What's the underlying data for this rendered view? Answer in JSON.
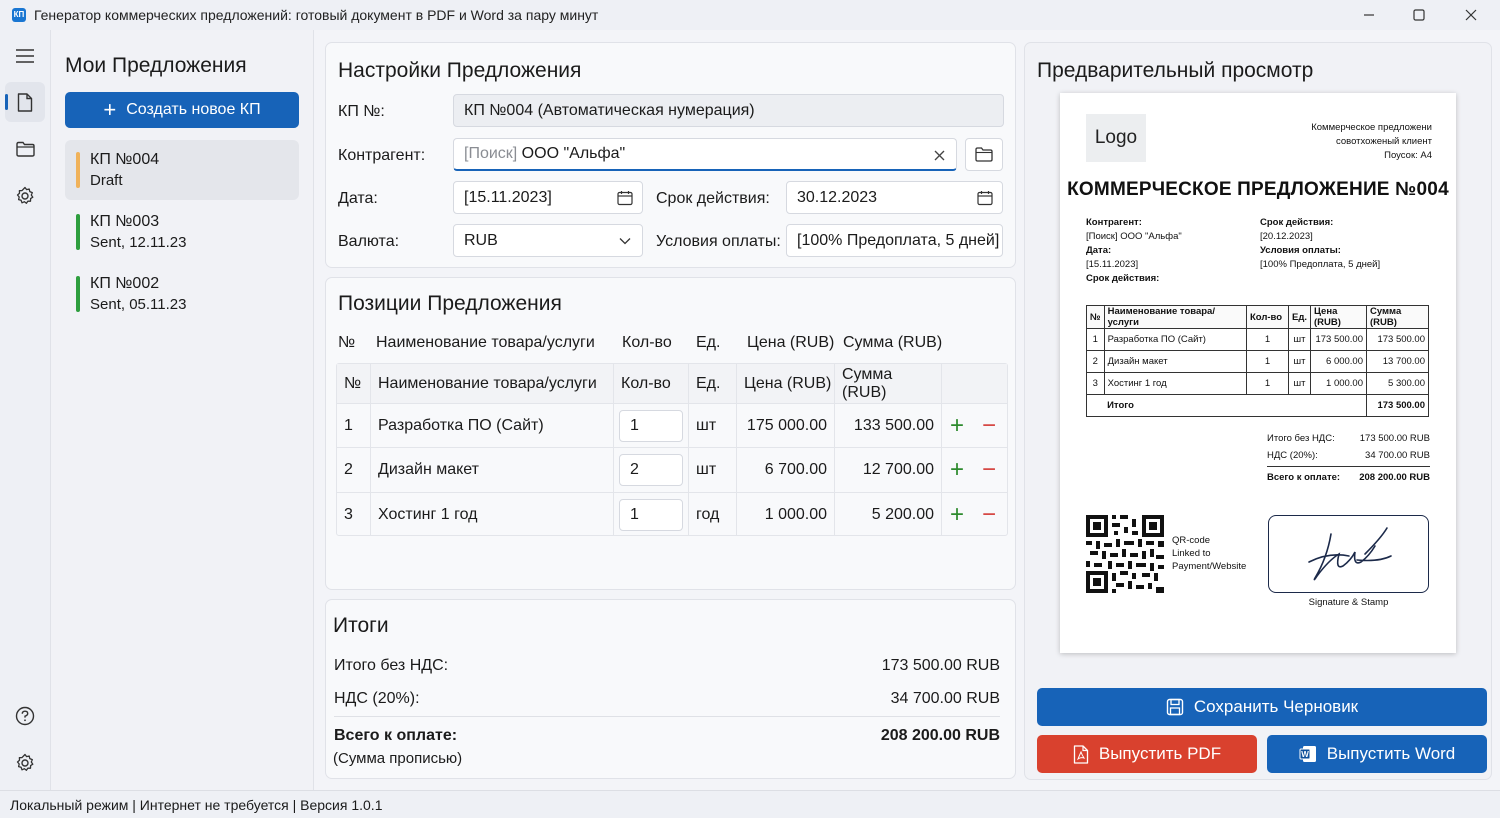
{
  "window": {
    "title": "Генератор коммерческих предложений: готовый документ в PDF и Word за пару минут",
    "app_icon_text": "КП"
  },
  "sidebar": {
    "title": "Мои Предложения",
    "create_button": "Создать новое КП",
    "offers": [
      {
        "title": "КП №004",
        "status": "Draft",
        "color": "#f0b25a"
      },
      {
        "title": "КП №003",
        "status": "Sent, 12.11.23",
        "color": "#2e9e3e"
      },
      {
        "title": "КП №002",
        "status": "Sent, 05.11.23",
        "color": "#2e9e3e"
      }
    ]
  },
  "settings": {
    "title": "Настройки Предложения",
    "number_label": "КП №:",
    "number_value": "КП №004 (Автоматическая нумерация)",
    "contractor_label": "Контрагент:",
    "contractor_placeholder": "[Поиск]",
    "contractor_value": " ООО \"Альфа\"",
    "date_label": "Дата:",
    "date_value": "[15.11.2023]",
    "validity_label": "Срок действия:",
    "validity_value": "30.12.2023",
    "currency_label": "Валюта:",
    "currency_value": "RUB",
    "payment_label": "Условия оплаты:",
    "payment_value": "[100% Предоплата, 5 дней]"
  },
  "positions": {
    "title": "Позиции Предложения",
    "columns": [
      "№",
      "Наименование товара/услуги",
      "Кол-во",
      "Ед.",
      "Цена (RUB)",
      "Сумма (RUB)"
    ],
    "rows": [
      {
        "n": "1",
        "name": "Разработка ПО (Сайт)",
        "qty": "1",
        "unit": "шт",
        "price": "175 000.00",
        "sum": "133 500.00"
      },
      {
        "n": "2",
        "name": "Дизайн макет",
        "qty": "2",
        "unit": "шт",
        "price": "6 700.00",
        "sum": "12 700.00"
      },
      {
        "n": "3",
        "name": "Хостинг 1 год",
        "qty": "1",
        "unit": "год",
        "price": "1 000.00",
        "sum": "5 200.00"
      }
    ]
  },
  "totals": {
    "title": "Итоги",
    "net_label": "Итого без НДС:",
    "net_value": "173 500.00 RUB",
    "vat_label": "НДС (20%):",
    "vat_value": "34 700.00 RUB",
    "total_label": "Всего к оплате:",
    "total_value": "208 200.00 RUB",
    "words_label": "(Сумма прописью)"
  },
  "preview": {
    "title": "Предварительный просмотр",
    "logo": "Logo",
    "header_lines": [
      "Коммерческое предложени",
      "совотхоженый клиент",
      "Поусок: А4"
    ],
    "doc_title": "КОММЕРЧЕСКОЕ ПРЕДЛОЖЕНИЕ №004",
    "left_info": [
      {
        "label": "Контрагент:",
        "value": "[Поиск] ООО \"Альфа\""
      },
      {
        "label": "Дата:",
        "value": "[15.11.2023]"
      },
      {
        "label": "Срок действия:",
        "value": ""
      }
    ],
    "right_info": [
      {
        "label": "Срок действия:",
        "value": "[20.12.2023]"
      },
      {
        "label": "Условия оплаты:",
        "value": "[100% Предоплата, 5 дней]"
      }
    ],
    "table_head": [
      "№",
      "Наименование товара/услуги",
      "Кол-во",
      "Ед.",
      "Цена (RUB)",
      "Сумма (RUB)"
    ],
    "table_rows": [
      [
        "1",
        "Разработка ПО (Сайт)",
        "1",
        "шт",
        "173 500.00",
        "173 500.00"
      ],
      [
        "2",
        "Дизайн макет",
        "1",
        "шт",
        "6 000.00",
        "13 700.00"
      ],
      [
        "3",
        "Хостинг 1 год",
        "1",
        "шт",
        "1 000.00",
        "5 300.00"
      ]
    ],
    "table_total_label": "Итого",
    "table_total_value": "173 500.00",
    "sum_net_label": "Итого без НДС:",
    "sum_net_value": "173 500.00 RUB",
    "sum_vat_label": "НДС (20%):",
    "sum_vat_value": "34 700.00 RUB",
    "sum_total_label": "Всего к оплате:",
    "sum_total_value": "208 200.00 RUB",
    "qr_text": [
      "QR-code",
      "Linked to",
      "Payment/Website"
    ],
    "signature_caption": "Signature & Stamp"
  },
  "actions": {
    "save_draft": "Сохранить Черновик",
    "issue_pdf": "Выпустить PDF",
    "issue_word": "Выпустить Word",
    "save_color": "#1763b8",
    "pdf_color": "#d9412e",
    "word_color": "#1763b8"
  },
  "statusbar": {
    "text": "Локальный режим | Интернет не требуется | Версия 1.0.1"
  }
}
